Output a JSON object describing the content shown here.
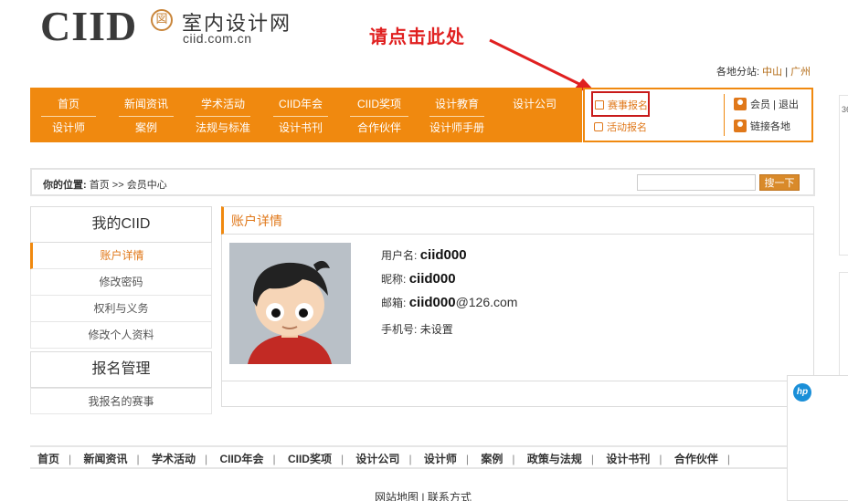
{
  "logo": {
    "word": "CIID",
    "seal": "図",
    "cn_name": "室内设计网",
    "url": "ciid.com.cn"
  },
  "annotation": {
    "text": "请点击此处"
  },
  "branches": {
    "label": "各地分站:",
    "items": [
      "中山",
      "广州"
    ],
    "sep": "|"
  },
  "nav": {
    "row1": [
      "首页",
      "新闻资讯",
      "学术活动",
      "CIID年会",
      "CIID奖项",
      "设计教育",
      "设计公司"
    ],
    "row2": [
      "设计师",
      "案例",
      "法规与标准",
      "设计书刊",
      "合作伙伴",
      "设计师手册"
    ]
  },
  "sidebox": {
    "contest_signup": "赛事报名",
    "event_signup": "活动报名",
    "member": "会员",
    "sep": "|",
    "logout": "退出",
    "links": "链接各地"
  },
  "breadcrumb": {
    "label": "你的位置:",
    "home": "首页",
    "arrow": ">>",
    "current": "会员中心"
  },
  "search": {
    "button": "搜一下",
    "value": ""
  },
  "left_menu": {
    "section1": "我的CIID",
    "items1": [
      "账户详情",
      "修改密码",
      "权利与义务",
      "修改个人资料"
    ],
    "section2": "报名管理",
    "items2": [
      "我报名的赛事"
    ]
  },
  "account": {
    "title": "账户详情",
    "username_label": "用户名:",
    "username": "ciid000",
    "nickname_label": "昵称:",
    "nickname": "ciid000",
    "email_label": "邮箱:",
    "email_user": "ciid000",
    "email_domain": "@126.com",
    "phone_label": "手机号:",
    "phone": "未设置"
  },
  "footer": {
    "links": [
      "首页",
      "新闻资讯",
      "学术活动",
      "CIID年会",
      "CIID奖项",
      "设计公司",
      "设计师",
      "案例",
      "政策与法规",
      "设计书刊",
      "合作伙伴"
    ],
    "sep": "|",
    "sitemap": "网站地图",
    "contact": "联系方式"
  },
  "side_widgets": {
    "partial_text": "36",
    "hp_logo": "hp"
  },
  "colors": {
    "orange": "#f0890f",
    "annotation_red": "#e02020",
    "highlight_red": "#c81a1a"
  }
}
